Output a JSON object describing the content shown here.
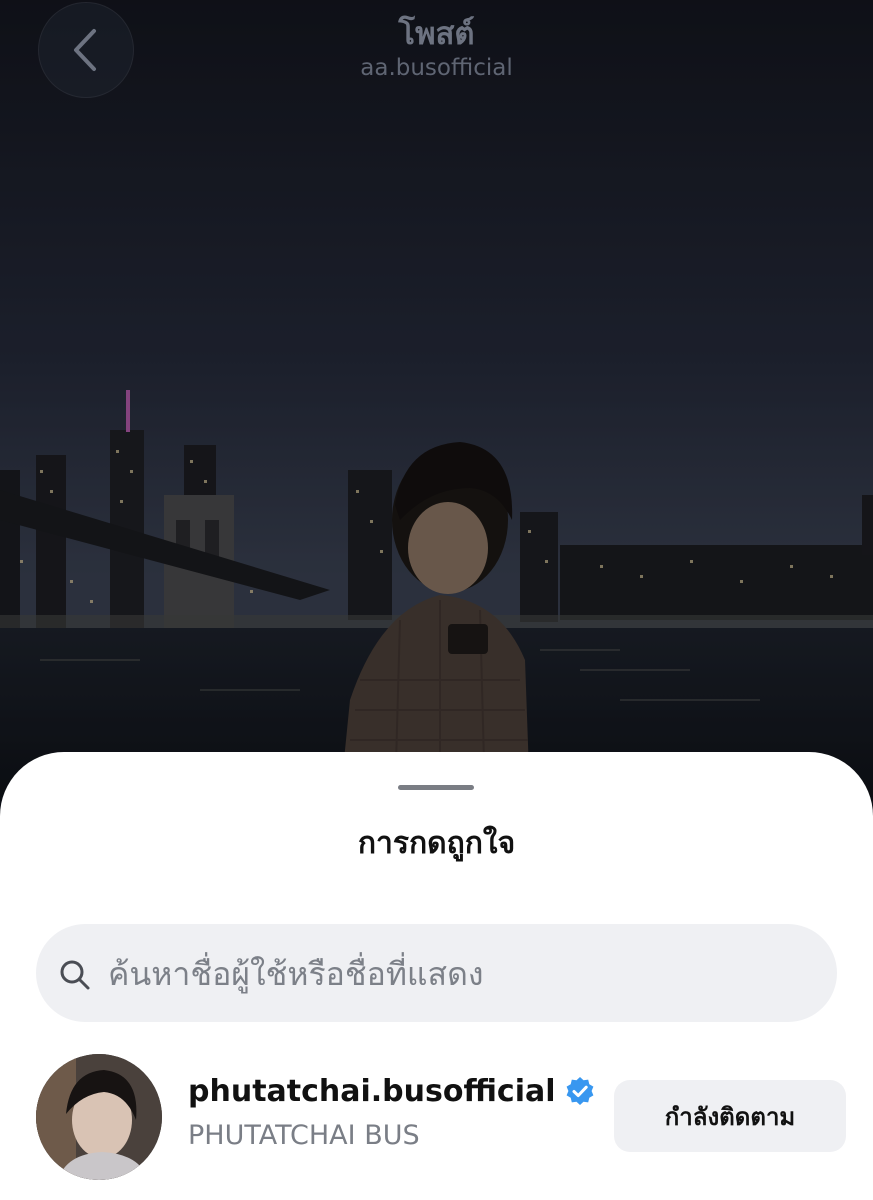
{
  "header": {
    "title": "โพสต์",
    "subtitle": "aa.busofficial",
    "back_icon": "chevron-left-icon"
  },
  "sheet": {
    "title": "การกดถูกใจ",
    "search": {
      "placeholder": "ค้นหาชื่อผู้ใช้หรือชื่อที่แสดง",
      "value": "",
      "icon": "search-icon"
    },
    "likes": [
      {
        "username": "phutatchai.busofficial",
        "full_name": "PHUTATCHAI BUS",
        "verified": true,
        "button_label": "กำลังติดตาม"
      }
    ]
  },
  "colors": {
    "verified_badge": "#3897f0",
    "sheet_background": "#ffffff",
    "field_background": "#eff0f3",
    "secondary_text": "#7a7e86"
  }
}
